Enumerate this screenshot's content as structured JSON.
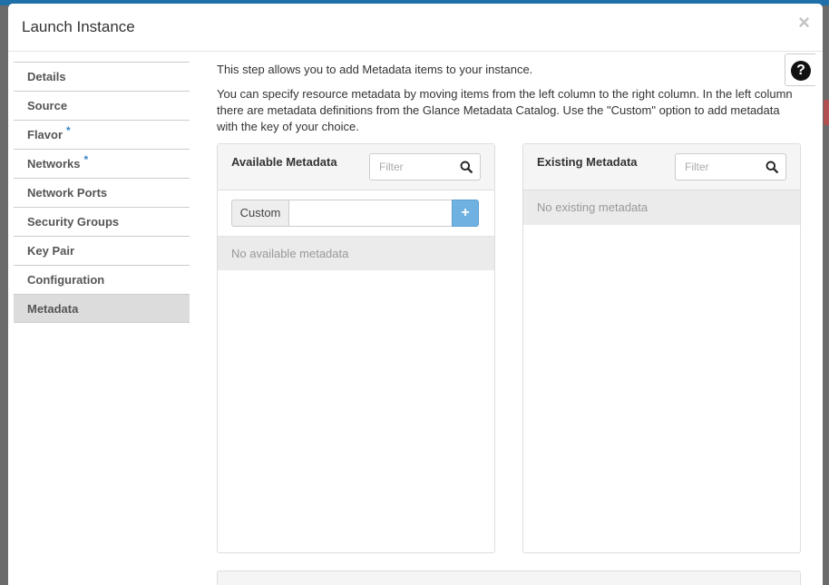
{
  "modal": {
    "title": "Launch Instance",
    "close_label": "×",
    "help_label": "?"
  },
  "sidebar": {
    "items": [
      {
        "label": "Details",
        "required": false
      },
      {
        "label": "Source",
        "required": false
      },
      {
        "label": "Flavor",
        "required": true
      },
      {
        "label": "Networks",
        "required": true
      },
      {
        "label": "Network Ports",
        "required": false
      },
      {
        "label": "Security Groups",
        "required": false
      },
      {
        "label": "Key Pair",
        "required": false
      },
      {
        "label": "Configuration",
        "required": false
      },
      {
        "label": "Metadata",
        "required": false,
        "active": true
      }
    ],
    "required_marker": "*"
  },
  "main": {
    "intro": "This step allows you to add Metadata items to your instance.",
    "description": "You can specify resource metadata by moving items from the left column to the right column. In the left column there are metadata definitions from the Glance Metadata Catalog. Use the \"Custom\" option to add metadata with the key of your choice."
  },
  "available": {
    "title": "Available Metadata",
    "filter_placeholder": "Filter",
    "custom_label": "Custom",
    "custom_value": "",
    "add_label": "+",
    "empty_text": "No available metadata"
  },
  "existing": {
    "title": "Existing Metadata",
    "filter_placeholder": "Filter",
    "empty_text": "No existing metadata"
  },
  "colors": {
    "accent": "#3a87c8",
    "add_button": "#6fb1e0",
    "active_nav": "#dcdcdc"
  }
}
